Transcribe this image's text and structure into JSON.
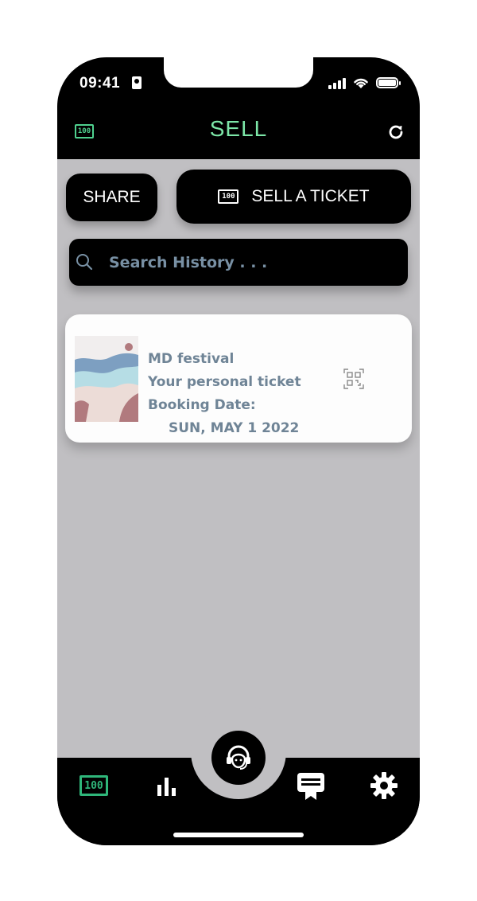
{
  "status_bar": {
    "time": "09:41"
  },
  "header": {
    "title": "SELL",
    "ticket_icon_text": "100",
    "title_color": "#7de7a8",
    "accent_color": "#4fd18f"
  },
  "actions": {
    "share_label": "SHARE",
    "sell_label": "SELL A TICKET",
    "sell_icon_text": "100"
  },
  "search": {
    "placeholder": "Search History . . ."
  },
  "tickets": [
    {
      "event": "MD festival",
      "subtitle": "Your personal ticket",
      "booking_label": "Booking Date:",
      "booking_date": "SUN, MAY 1 2022"
    }
  ],
  "bottom_nav": {
    "items": [
      {
        "icon": "ticket-icon",
        "text": "100",
        "active": true
      },
      {
        "icon": "bar-chart-icon"
      },
      {
        "icon": "support-agent-icon"
      },
      {
        "icon": "voucher-icon"
      },
      {
        "icon": "gear-icon"
      }
    ]
  },
  "colors": {
    "background": "#c0bfc2",
    "card_text": "#6f8496",
    "search_text": "#7890a4"
  }
}
